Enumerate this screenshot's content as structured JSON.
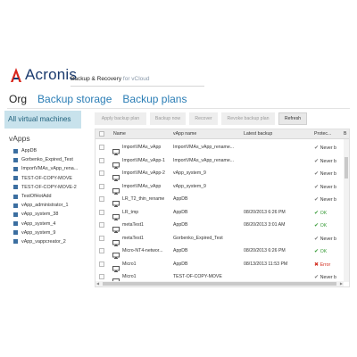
{
  "header": {
    "logo": "Acronis",
    "product_brand": "Backup & Recovery",
    "product_suffix": "for vCloud"
  },
  "nav": {
    "tabs": [
      "Org",
      "Backup storage",
      "Backup plans"
    ],
    "active": "Org"
  },
  "sidebar": {
    "selected": "All virtual machines",
    "section": "vApps",
    "items": [
      "AppDB",
      "Gorbenko_Expired_Test",
      "ImportVMAs_vApp_rena...",
      "TEST-OF-COPY-MOVE",
      "TEST-OF-COPY-MOVE-2",
      "TestOfHotAdd",
      "vApp_administrator_1",
      "vApp_system_38",
      "vApp_system_4",
      "vApp_system_9",
      "vApp_vappcreator_2"
    ]
  },
  "toolbar": {
    "apply": "Apply backup plan",
    "backup": "Backup now",
    "recover": "Recover",
    "revoke": "Revoke backup plan",
    "refresh": "Refresh"
  },
  "table": {
    "columns": [
      "Name",
      "vApp name",
      "Latest backup",
      "Protec...",
      "B"
    ],
    "rows": [
      {
        "name": "ImportVMAs_vApp",
        "vapp": "ImportVMAs_vApp_rename...",
        "latest": "",
        "status": "Never b",
        "status_type": "never"
      },
      {
        "name": "ImportVMAs_vApp-1",
        "vapp": "ImportVMAs_vApp_rename...",
        "latest": "",
        "status": "Never b",
        "status_type": "never"
      },
      {
        "name": "ImportVMAs_vApp-2",
        "vapp": "vApp_system_9",
        "latest": "",
        "status": "Never b",
        "status_type": "never"
      },
      {
        "name": "ImportVMAs_vApp",
        "vapp": "vApp_system_9",
        "latest": "",
        "status": "Never b",
        "status_type": "never"
      },
      {
        "name": "LR_T2_thin_rename",
        "vapp": "AppDB",
        "latest": "",
        "status": "Never b",
        "status_type": "never"
      },
      {
        "name": "LR_tmp",
        "vapp": "AppDB",
        "latest": "08/20/2013 6:26 PM",
        "status": "OK",
        "status_type": "ok"
      },
      {
        "name": "metaTest1",
        "vapp": "AppDB",
        "latest": "08/20/2013 3:01 AM",
        "status": "OK",
        "status_type": "ok"
      },
      {
        "name": "metaTest1",
        "vapp": "Gorbenko_Expired_Test",
        "latest": "",
        "status": "Never b",
        "status_type": "never"
      },
      {
        "name": "Micro-NT4-networ...",
        "vapp": "AppDB",
        "latest": "08/20/2013 6:26 PM",
        "status": "OK",
        "status_type": "ok"
      },
      {
        "name": "Micro1",
        "vapp": "AppDB",
        "latest": "08/13/2013 11:53 PM",
        "status": "Error",
        "status_type": "error"
      },
      {
        "name": "Micro1",
        "vapp": "TEST-OF-COPY-MOVE",
        "latest": "",
        "status": "Never b",
        "status_type": "never"
      }
    ]
  },
  "colors": {
    "accent": "#2a7db5",
    "selected_bg": "#c8e2ec",
    "ok": "#3a9c3a",
    "error": "#d22c1e"
  }
}
